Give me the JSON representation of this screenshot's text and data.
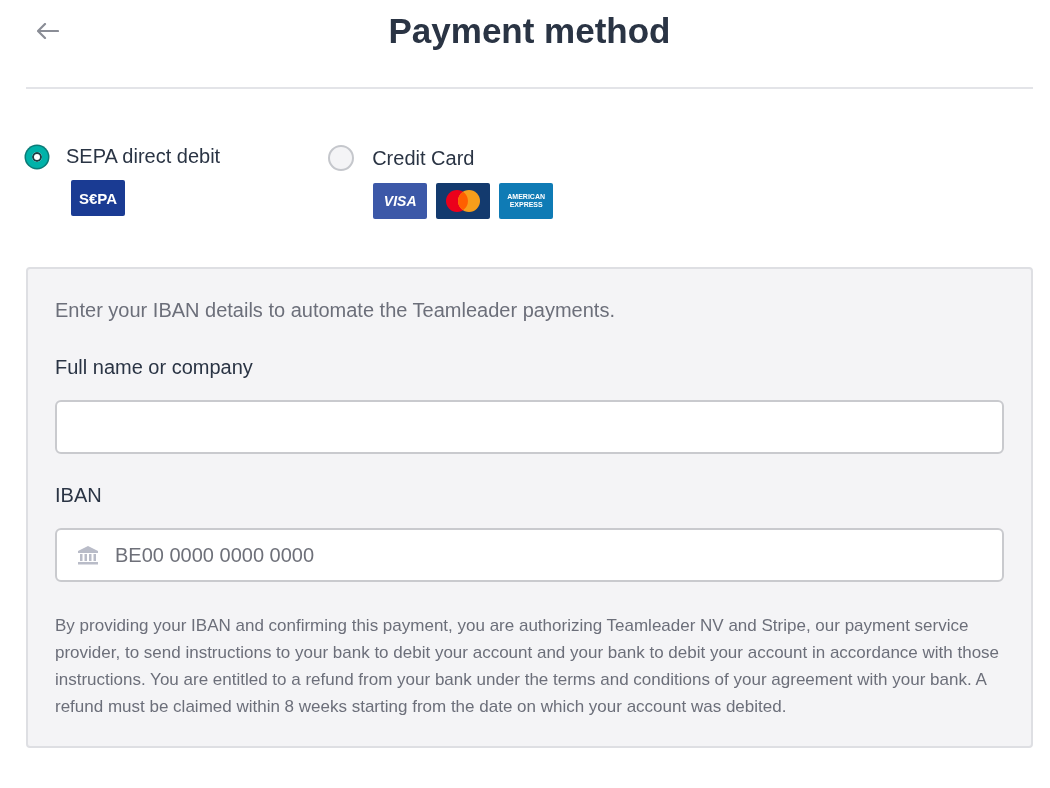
{
  "header": {
    "title": "Payment method"
  },
  "payment_options": [
    {
      "label": "SEPA direct debit",
      "selected": true,
      "logos": [
        {
          "kind": "sepa",
          "text": "S€PA"
        }
      ]
    },
    {
      "label": "Credit Card",
      "selected": false,
      "logos": [
        {
          "kind": "visa",
          "text": "VISA"
        },
        {
          "kind": "mastercard"
        },
        {
          "kind": "amex",
          "text": "AMERICAN EXPRESS"
        }
      ]
    }
  ],
  "panel": {
    "intro": "Enter your IBAN details to automate the Teamleader payments.",
    "fields": [
      {
        "kind": "text",
        "label": "Full name or company"
      },
      {
        "kind": "iban",
        "label": "IBAN",
        "placeholder": "BE00 0000 0000 0000"
      }
    ],
    "legal": "By providing your IBAN and confirming this payment, you are authorizing Teamleader NV and Stripe, our payment service provider, to send instructions to your bank to debit your account and your bank to debit your account in accordance with those instructions. You are entitled to a refund from your bank under the terms and conditions of your agreement with your bank. A refund must be claimed within 8 weeks starting from the date on which your account was debited."
  }
}
